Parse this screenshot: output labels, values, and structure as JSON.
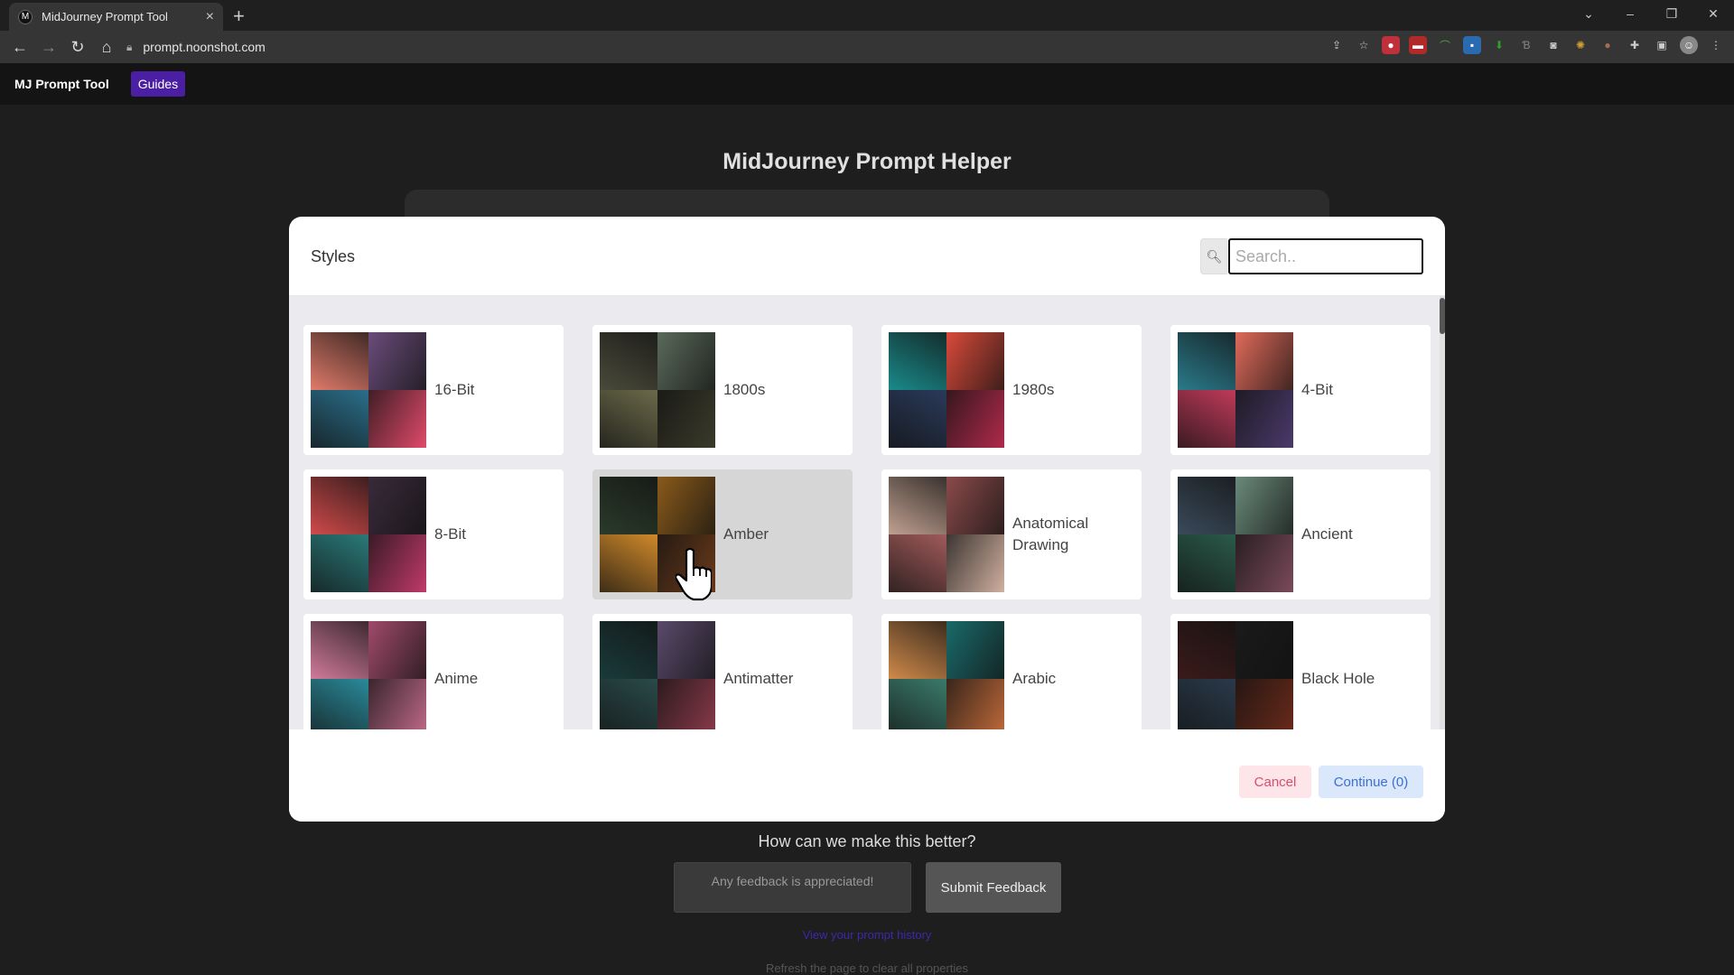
{
  "browser": {
    "tab_title": "MidJourney Prompt Tool",
    "favicon": "M",
    "url": "prompt.noonshot.com"
  },
  "app": {
    "brand": "MJ Prompt Tool",
    "guides_label": "Guides",
    "page_title": "MidJourney Prompt Helper"
  },
  "modal": {
    "title": "Styles",
    "search_placeholder": "Search..",
    "cancel_label": "Cancel",
    "continue_label": "Continue (0)",
    "styles": [
      {
        "label": "16-Bit",
        "colors": [
          "#e07b6a",
          "#6a4c7a",
          "#2a6f8a",
          "#e04a6a"
        ]
      },
      {
        "label": "1800s",
        "colors": [
          "#4a4a3a",
          "#5a6a5a",
          "#6b6a4a",
          "#3a3a2a"
        ]
      },
      {
        "label": "1980s",
        "colors": [
          "#1a8a8a",
          "#d94a3a",
          "#2a3a5a",
          "#b02a4a"
        ]
      },
      {
        "label": "4-Bit",
        "colors": [
          "#2a7a8a",
          "#e06a5a",
          "#c03a5a",
          "#4a3a6a"
        ]
      },
      {
        "label": "8-Bit",
        "colors": [
          "#d04a4a",
          "#3a2a3a",
          "#2a7a7a",
          "#c03a6a"
        ]
      },
      {
        "label": "Amber",
        "colors": [
          "#2a3a2a",
          "#8a5a1a",
          "#d08a2a",
          "#6a3a1a"
        ]
      },
      {
        "label": "Anatomical Drawing",
        "colors": [
          "#c0a090",
          "#8a4a4a",
          "#a05a5a",
          "#d0b0a0"
        ]
      },
      {
        "label": "Ancient",
        "colors": [
          "#3a4a5a",
          "#6a8a7a",
          "#2a5a4a",
          "#7a4a5a"
        ]
      },
      {
        "label": "Anime",
        "colors": [
          "#d07a9a",
          "#a04a6a",
          "#2a8a9a",
          "#c06a8a"
        ]
      },
      {
        "label": "Antimatter",
        "colors": [
          "#1a3a3a",
          "#5a4a6a",
          "#2a4a4a",
          "#8a3a4a"
        ]
      },
      {
        "label": "Arabic",
        "colors": [
          "#d08a4a",
          "#1a6a6a",
          "#3a7a6a",
          "#c06a3a"
        ]
      },
      {
        "label": "Black Hole",
        "colors": [
          "#3a1a1a",
          "#1a1a1a",
          "#2a3a4a",
          "#6a2a1a"
        ]
      }
    ]
  },
  "feedback": {
    "title": "How can we make this better?",
    "placeholder": "Any feedback is appreciated!",
    "submit_label": "Submit Feedback",
    "history_link": "View your prompt history",
    "refresh_note": "Refresh the page to clear all properties"
  }
}
